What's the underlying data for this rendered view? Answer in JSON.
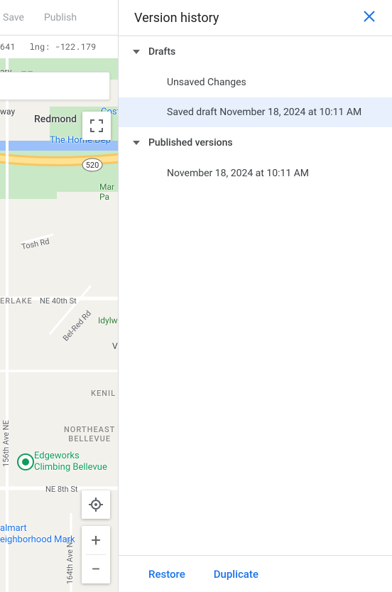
{
  "toolbar": {
    "save": "Save",
    "publish": "Publish"
  },
  "coords": {
    "lat": "641",
    "lng_label": "lng:",
    "lng": "-122.179"
  },
  "map": {
    "city": "Redmond",
    "home_depot": "The Home Dep",
    "costco_prefix": "Cost",
    "park_name": "Mar\nPa",
    "idylwood": "Idylw",
    "initial_v": "V",
    "road_tosh": "Tosh Rd",
    "road_belred": "Bel-Red Rd",
    "road_ne40": "NE 40th St",
    "road_ne8": "NE 8th St",
    "road_156": "156th Ave NE",
    "road_164": "164th Ave NE",
    "hwy_520": "520",
    "neigh_overlake": "ERLAKE",
    "neigh_kenil": "KENIL",
    "neigh_ne_bellevue": "NORTHEAST\nBELLEVUE",
    "poi_edgeworks": "Edgeworks\nClimbing Bellevue",
    "poi_walmart": "almart\neighborhood Mark",
    "library_tag": "ary"
  },
  "panel": {
    "title": "Version history",
    "sections": {
      "drafts": {
        "title": "Drafts",
        "items": [
          "Unsaved Changes",
          "Saved draft November 18, 2024 at 10:11 AM"
        ]
      },
      "published": {
        "title": "Published versions",
        "items": [
          "November 18, 2024 at 10:11 AM"
        ]
      }
    },
    "footer": {
      "restore": "Restore",
      "duplicate": "Duplicate"
    }
  }
}
